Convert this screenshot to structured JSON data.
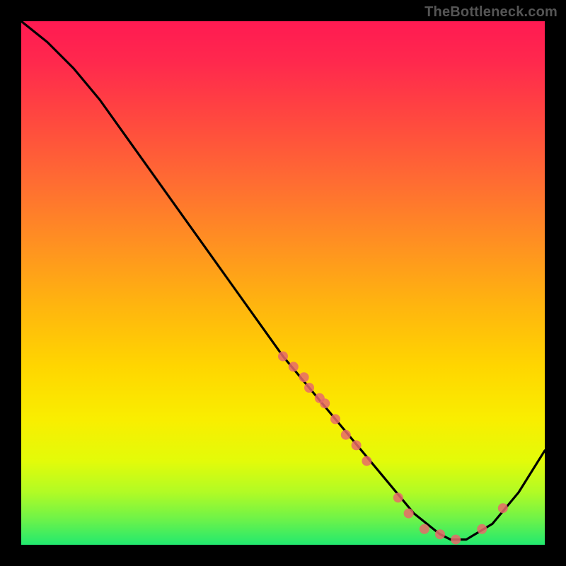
{
  "watermark": "TheBottleneck.com",
  "chart_data": {
    "type": "line",
    "title": "",
    "xlabel": "",
    "ylabel": "",
    "xlim": [
      0,
      100
    ],
    "ylim": [
      0,
      100
    ],
    "grid": false,
    "legend": false,
    "series": [
      {
        "name": "bottleneck-curve",
        "x": [
          0,
          5,
          10,
          15,
          20,
          25,
          30,
          35,
          40,
          45,
          50,
          55,
          60,
          65,
          70,
          75,
          80,
          82,
          85,
          90,
          95,
          100
        ],
        "y": [
          100,
          96,
          91,
          85,
          78,
          71,
          64,
          57,
          50,
          43,
          36,
          30,
          24,
          18,
          12,
          6,
          2,
          1,
          1,
          4,
          10,
          18
        ]
      }
    ],
    "markers": {
      "name": "highlight-points",
      "color": "#e76a6a",
      "points_x": [
        50,
        52,
        54,
        55,
        57,
        58,
        60,
        62,
        64,
        66,
        72,
        74,
        77,
        80,
        83,
        88,
        92
      ],
      "points_y": [
        36,
        34,
        32,
        30,
        28,
        27,
        24,
        21,
        19,
        16,
        9,
        6,
        3,
        2,
        1,
        3,
        7
      ]
    },
    "background_gradient": {
      "top": "#ff1a52",
      "mid": "#ffd600",
      "bottom": "#22e96f"
    }
  }
}
